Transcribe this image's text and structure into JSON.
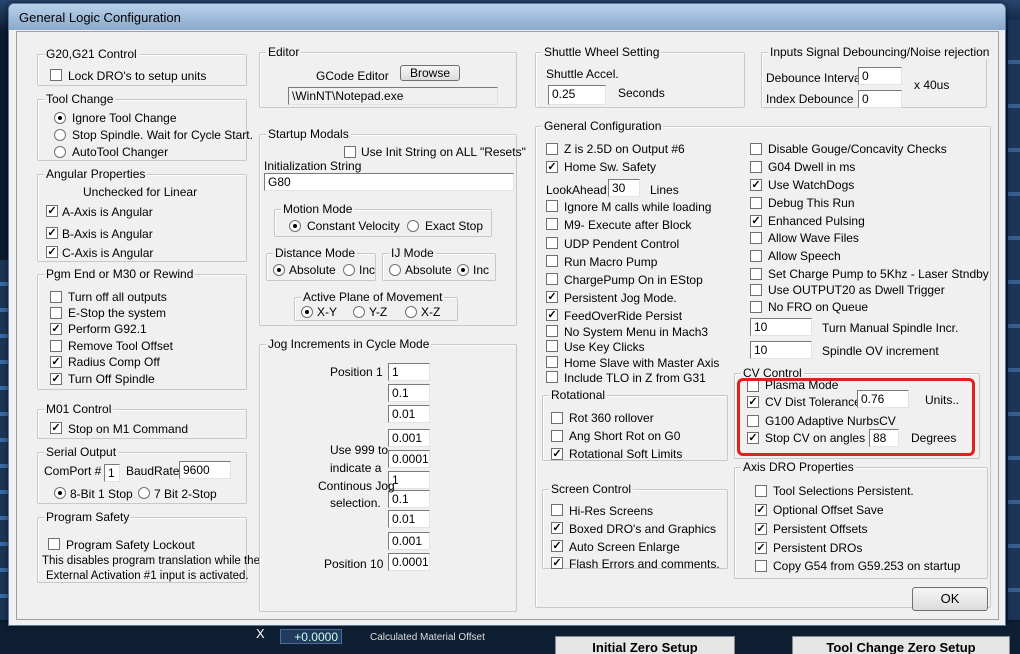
{
  "window": {
    "title": "General Logic Configuration"
  },
  "g2021": {
    "title": "G20,G21 Control",
    "lock": {
      "label": "Lock DRO's to setup units",
      "checked": false
    }
  },
  "toolchange": {
    "title": "Tool Change",
    "options": [
      {
        "label": "Ignore Tool Change",
        "selected": true
      },
      {
        "label": "Stop Spindle. Wait for Cycle Start.",
        "selected": false
      },
      {
        "label": "AutoTool Changer",
        "selected": false
      }
    ]
  },
  "angular": {
    "title": "Angular Properties",
    "note": "Unchecked for Linear",
    "items": [
      {
        "label": "A-Axis is Angular",
        "checked": true
      },
      {
        "label": "B-Axis is Angular",
        "checked": true
      },
      {
        "label": "C-Axis is Angular",
        "checked": true
      }
    ]
  },
  "pgmend": {
    "title": "Pgm End or M30 or Rewind",
    "items": [
      {
        "label": "Turn off all outputs",
        "checked": false
      },
      {
        "label": "E-Stop the system",
        "checked": false
      },
      {
        "label": "Perform G92.1",
        "checked": true
      },
      {
        "label": "Remove Tool Offset",
        "checked": false
      },
      {
        "label": "Radius Comp Off",
        "checked": true
      },
      {
        "label": "Turn Off Spindle",
        "checked": true
      }
    ]
  },
  "m01": {
    "title": "M01 Control",
    "stop": {
      "label": "Stop on M1 Command",
      "checked": true
    }
  },
  "serial": {
    "title": "Serial Output",
    "comport_label": "ComPort #",
    "comport": "1",
    "baud_label": "BaudRate",
    "baud": "9600",
    "options": [
      {
        "label": "8-Bit 1 Stop",
        "selected": true
      },
      {
        "label": "7 Bit 2-Stop",
        "selected": false
      }
    ]
  },
  "safety": {
    "title": "Program Safety",
    "lock": {
      "label": "Program Safety Lockout",
      "checked": false
    },
    "desc1": "This disables program translation while the",
    "desc2": "External Activation #1 input is activated."
  },
  "editor": {
    "title": "Editor",
    "label": "GCode Editor",
    "browse": "Browse",
    "path": "\\WinNT\\Notepad.exe"
  },
  "startup": {
    "title": "Startup Modals",
    "use_init": {
      "label": "Use Init String on ALL  \"Resets\"",
      "checked": false
    },
    "init_label": "Initialization String",
    "init_value": "G80"
  },
  "motion": {
    "title": "Motion Mode",
    "options": [
      {
        "label": "Constant Velocity",
        "selected": true
      },
      {
        "label": "Exact Stop",
        "selected": false
      }
    ]
  },
  "distance": {
    "title": "Distance Mode",
    "options": [
      {
        "label": "Absolute",
        "selected": true
      },
      {
        "label": "Inc",
        "selected": false
      }
    ]
  },
  "ij": {
    "title": "IJ Mode",
    "options": [
      {
        "label": "Absolute",
        "selected": false
      },
      {
        "label": "Inc",
        "selected": true
      }
    ]
  },
  "plane": {
    "title": "Active Plane of Movement",
    "options": [
      {
        "label": "X-Y",
        "selected": true
      },
      {
        "label": "Y-Z",
        "selected": false
      },
      {
        "label": "X-Z",
        "selected": false
      }
    ]
  },
  "jog": {
    "title": "Jog Increments in Cycle Mode",
    "pos1": "Position 1",
    "pos10": "Position 10",
    "note": [
      "Use 999 to",
      "indicate a",
      "Continous Jog",
      "selection."
    ],
    "values": [
      "1",
      "0.1",
      "0.01",
      "0.001",
      "0.0001",
      "1",
      "0.1",
      "0.01",
      "0.001",
      "0.0001"
    ]
  },
  "shuttle": {
    "title": "Shuttle Wheel Setting",
    "accel_label": "Shuttle Accel.",
    "accel": "0.25",
    "unit": "Seconds"
  },
  "debounce": {
    "title": "Inputs Signal Debouncing/Noise rejection",
    "interval_label": "Debounce Interval",
    "interval": "0",
    "unit": "x 40us",
    "index_label": "Index Debounce",
    "index": "0"
  },
  "general": {
    "title": "General Configuration",
    "left": [
      {
        "label": "Z is 2.5D on Output #6",
        "checked": false
      },
      {
        "label": "Home Sw. Safety",
        "checked": true
      },
      {
        "label": "Ignore M calls while loading",
        "checked": false
      },
      {
        "label": "M9- Execute after Block",
        "checked": false
      },
      {
        "label": "UDP Pendent Control",
        "checked": false
      },
      {
        "label": "Run Macro Pump",
        "checked": false
      },
      {
        "label": "ChargePump On in EStop",
        "checked": false
      },
      {
        "label": "Persistent Jog Mode.",
        "checked": true
      },
      {
        "label": "FeedOverRide Persist",
        "checked": true
      },
      {
        "label": "No System Menu in Mach3",
        "checked": false
      },
      {
        "label": "Use Key Clicks",
        "checked": false
      },
      {
        "label": "Home Slave with Master Axis",
        "checked": false
      },
      {
        "label": "Include TLO in Z from G31",
        "checked": false
      }
    ],
    "lookahead_label": "LookAhead",
    "lookahead": "30",
    "lines": "Lines",
    "right": [
      {
        "label": "Disable Gouge/Concavity Checks",
        "checked": false
      },
      {
        "label": "G04 Dwell in ms",
        "checked": false
      },
      {
        "label": "Use WatchDogs",
        "checked": true
      },
      {
        "label": "Debug This Run",
        "checked": false
      },
      {
        "label": "Enhanced Pulsing",
        "checked": true
      },
      {
        "label": "Allow Wave Files",
        "checked": false
      },
      {
        "label": "Allow Speech",
        "checked": false
      },
      {
        "label": "Set Charge Pump to 5Khz  - Laser Stndby",
        "checked": false
      },
      {
        "label": "Use OUTPUT20 as Dwell Trigger",
        "checked": false
      },
      {
        "label": "No FRO on Queue",
        "checked": false
      }
    ],
    "manual_spindle": "10",
    "manual_spindle_label": "Turn Manual Spindle Incr.",
    "spindle_ov": "10",
    "spindle_ov_label": "Spindle OV increment"
  },
  "rotational": {
    "title": "Rotational",
    "items": [
      {
        "label": "Rot 360 rollover",
        "checked": false
      },
      {
        "label": "Ang Short Rot on G0",
        "checked": false
      },
      {
        "label": "Rotational Soft Limits",
        "checked": true
      }
    ]
  },
  "screen": {
    "title": "Screen Control",
    "items": [
      {
        "label": "Hi-Res Screens",
        "checked": false
      },
      {
        "label": "Boxed DRO's and Graphics",
        "checked": true
      },
      {
        "label": "Auto Screen Enlarge",
        "checked": true
      },
      {
        "label": "Flash Errors and comments.",
        "checked": true
      }
    ]
  },
  "cv": {
    "title": "CV Control",
    "plasma": {
      "label": "Plasma Mode",
      "checked": false
    },
    "tolerance": {
      "label": "CV Dist Tolerance",
      "checked": true
    },
    "tolerance_value": "0.76",
    "units": "Units..",
    "g100": {
      "label": "G100 Adaptive NurbsCV",
      "checked": false
    },
    "stop": {
      "label": "Stop CV on angles >",
      "checked": true
    },
    "angle": "88",
    "degrees": "Degrees",
    "highlight_color": "#e0201a"
  },
  "axisdro": {
    "title": "Axis DRO Properties",
    "items": [
      {
        "label": "Tool Selections Persistent.",
        "checked": false
      },
      {
        "label": "Optional Offset Save",
        "checked": true
      },
      {
        "label": "Persistent Offsets",
        "checked": true
      },
      {
        "label": "Persistent DROs",
        "checked": true
      },
      {
        "label": "Copy G54 from G59.253 on startup",
        "checked": false
      }
    ]
  },
  "ok": "OK",
  "background": {
    "x_label": "X",
    "x_value": "+0.0000",
    "material": "Calculated Material Offset",
    "btn1": "Initial Zero Setup",
    "btn2": "Tool Change Zero Setup"
  }
}
